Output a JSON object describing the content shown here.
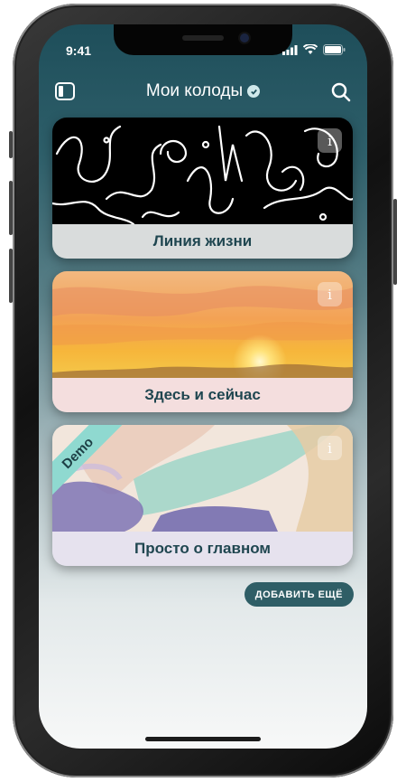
{
  "status": {
    "time": "9:41"
  },
  "header": {
    "title": "Мои колоды",
    "check_icon": "check-badge-icon",
    "left_icon": "sidebar-icon",
    "right_icon": "search-icon"
  },
  "decks": [
    {
      "name": "Линия жизни",
      "label_bg": "#d9dcdc"
    },
    {
      "name": "Здесь и сейчас",
      "label_bg": "#f4dede"
    },
    {
      "name": "Просто о главном",
      "label_bg": "#e6e2ee",
      "badge": "Demo"
    }
  ],
  "info_label": "i",
  "add_button": "ДОБАВИТЬ ЕЩЁ",
  "colors": {
    "accent": "#2f5e66",
    "bg_top": "#1e4e5a",
    "demo": "#8fd9d0"
  }
}
